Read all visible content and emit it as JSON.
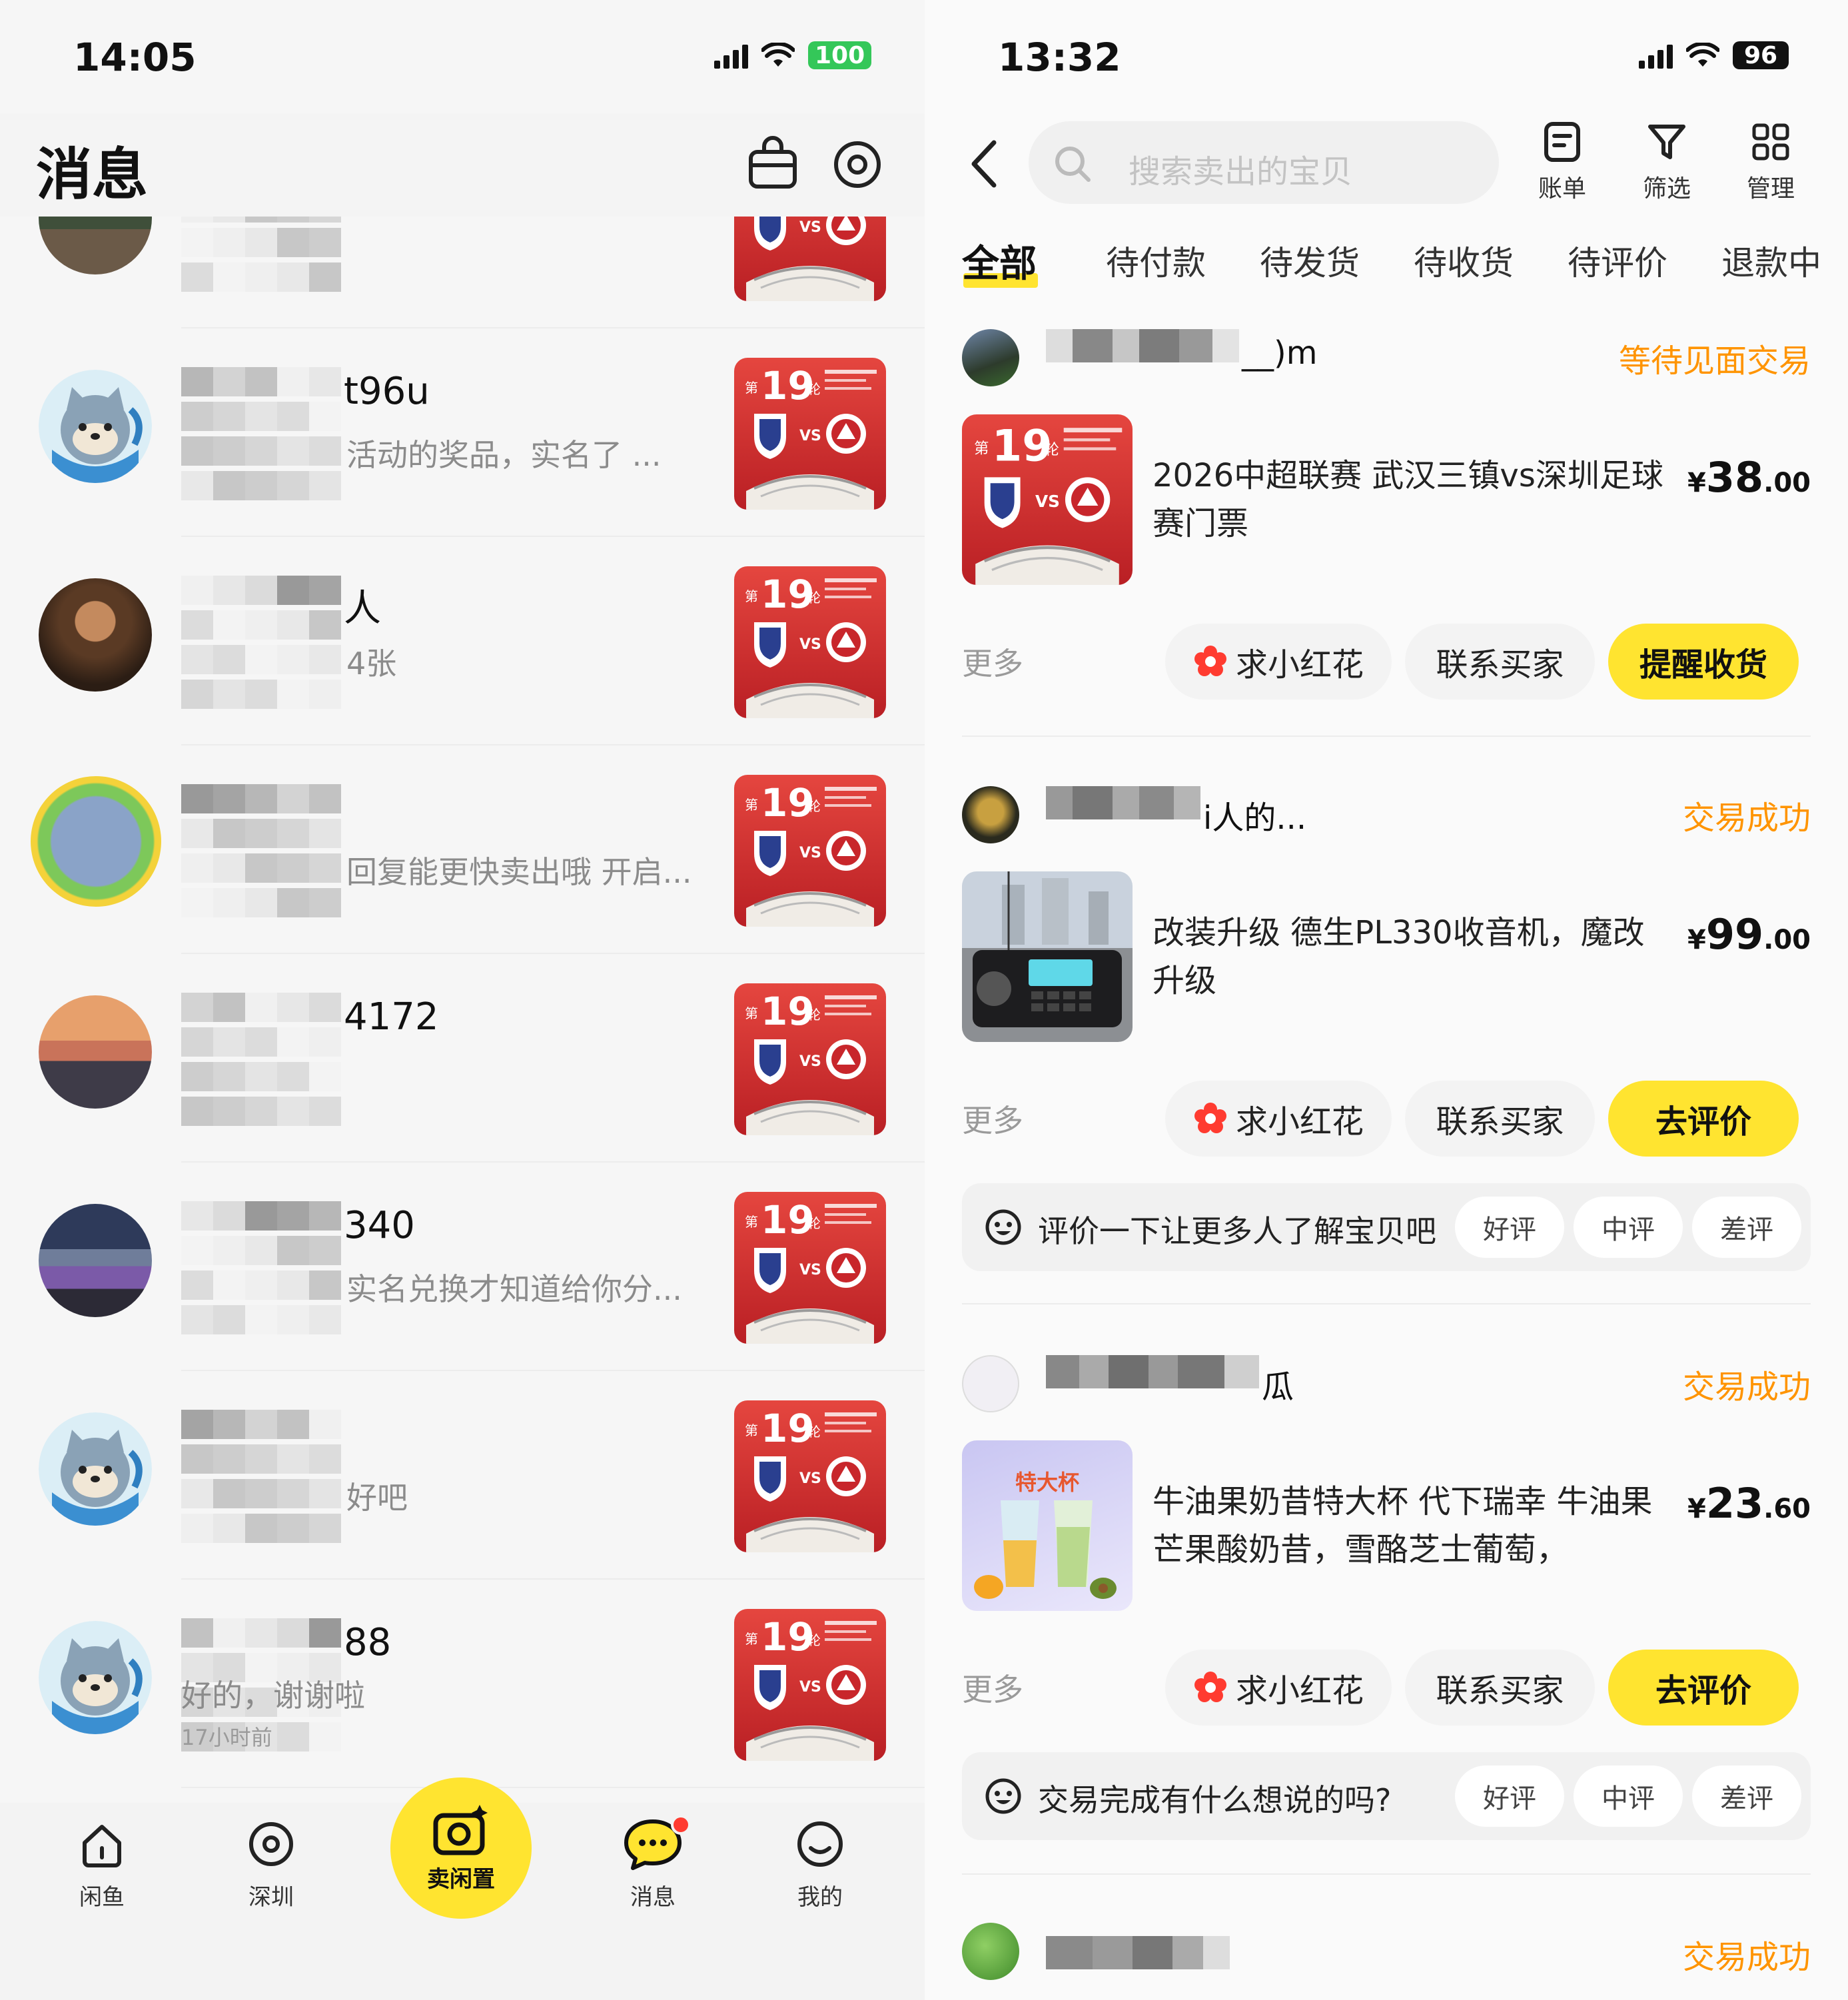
{
  "left": {
    "status": {
      "time": "14:05",
      "battery": "100"
    },
    "header": {
      "title": "消息"
    },
    "chats": [
      {
        "name": "",
        "preview": "",
        "avatar": "stadium-photo"
      },
      {
        "name": "t96u",
        "preview": "活动的奖品，实名了 ...",
        "avatar": "cat-avatar"
      },
      {
        "name": "人",
        "preview": "4张",
        "avatar": "person-photo"
      },
      {
        "name": "",
        "preview": "回复能更快卖出哦 开启...",
        "avatar": "framed-photo"
      },
      {
        "name": "4172",
        "preview": "",
        "avatar": "sunset-photo"
      },
      {
        "name": "340",
        "preview": "实名兑换才知道给你分...",
        "avatar": "night-photo"
      },
      {
        "name": "",
        "preview": "好吧",
        "avatar": "cat-avatar"
      },
      {
        "name": "88",
        "preview": "好的，谢谢啦",
        "time": "17小时前",
        "avatar": "cat-avatar"
      }
    ],
    "ticket_thumb": {
      "round_num": "19",
      "round_char": "轮",
      "prefix": "第",
      "vs": "VS"
    },
    "tabbar": {
      "items": [
        {
          "label": "闲鱼",
          "icon": "home-icon"
        },
        {
          "label": "深圳",
          "icon": "location-icon"
        },
        {
          "label": "卖闲置",
          "icon": "camera-icon"
        },
        {
          "label": "消息",
          "icon": "message-icon"
        },
        {
          "label": "我的",
          "icon": "profile-icon"
        }
      ]
    }
  },
  "right": {
    "status": {
      "time": "13:32",
      "battery": "96"
    },
    "search": {
      "placeholder": "搜索卖出的宝贝"
    },
    "nav_buttons": [
      {
        "label": "账单",
        "icon": "bill-icon"
      },
      {
        "label": "筛选",
        "icon": "filter-icon"
      },
      {
        "label": "管理",
        "icon": "grid-icon"
      }
    ],
    "tabs": [
      "全部",
      "待付款",
      "待发货",
      "待收货",
      "待评价",
      "退款中"
    ],
    "orders": [
      {
        "seller": "__)m",
        "status": "等待见面交易",
        "title": "2026中超联赛 武汉三镇vs深圳足球赛门票",
        "price_main": "38",
        "price_dec": ".00",
        "more": "更多",
        "actions": [
          "求小红花",
          "联系买家",
          "提醒收货"
        ]
      },
      {
        "seller": "i人的...",
        "status": "交易成功",
        "title": "改装升级 德生PL330收音机，魔改升级",
        "price_main": "99",
        "price_dec": ".00",
        "more": "更多",
        "actions": [
          "求小红花",
          "联系买家",
          "去评价"
        ],
        "review_prompt": "评价一下让更多人了解宝贝吧",
        "review_chips": [
          "好评",
          "中评",
          "差评"
        ]
      },
      {
        "seller": "瓜",
        "status": "交易成功",
        "title": "牛油果奶昔特大杯 代下瑞幸 牛油果芒果酸奶昔，雪酪芝士葡萄，",
        "price_main": "23",
        "price_dec": ".60",
        "more": "更多",
        "actions": [
          "求小红花",
          "联系买家",
          "去评价"
        ],
        "review_prompt": "交易完成有什么想说的吗?",
        "review_chips": [
          "好评",
          "中评",
          "差评"
        ],
        "thumb_label": "特大杯"
      },
      {
        "seller": "",
        "status": "交易成功"
      }
    ],
    "currency": "¥"
  }
}
